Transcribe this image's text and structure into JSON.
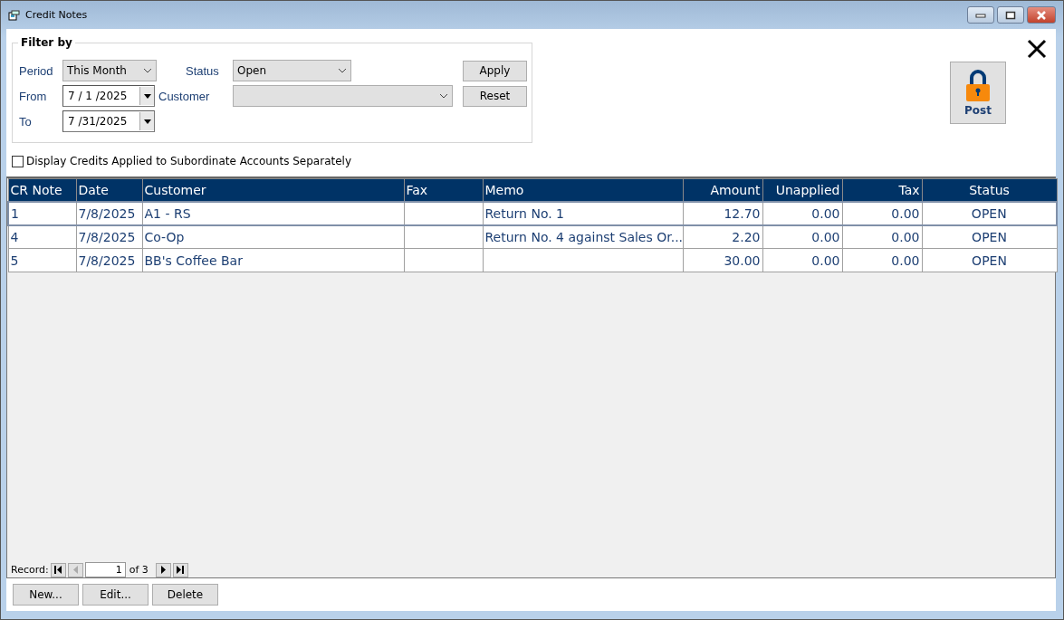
{
  "window": {
    "title": "Credit Notes"
  },
  "filter": {
    "title": "Filter by",
    "period": {
      "label": "Period",
      "value": "This Month"
    },
    "from": {
      "label": "From",
      "value": "7 / 1 /2025"
    },
    "to": {
      "label": "To",
      "value": "7 /31/2025"
    },
    "status": {
      "label": "Status",
      "value": "Open"
    },
    "customer": {
      "label": "Customer"
    },
    "buttons": [
      "Apply",
      "Reset"
    ]
  },
  "post_button": {
    "label": "Post"
  },
  "subordinate_checkbox": {
    "label": "Display Credits Applied to Subordinate Accounts Separately",
    "checked": false
  },
  "table": {
    "columns": [
      "CR Note",
      "Date",
      "Customer",
      "Fax",
      "Memo",
      "Amount",
      "Unapplied",
      "Tax",
      "Status"
    ],
    "rows": [
      {
        "cells": [
          "1",
          "7/8/2025",
          "A1 - RS",
          "",
          "Return No. 1",
          "12.70",
          "0.00",
          "0.00",
          "OPEN"
        ],
        "selected": true
      },
      {
        "cells": [
          "4",
          "7/8/2025",
          "Co-Op",
          "",
          "Return No. 4 against Sales Or...",
          "2.20",
          "0.00",
          "0.00",
          "OPEN"
        ],
        "selected": false
      },
      {
        "cells": [
          "5",
          "7/8/2025",
          "BB's Coffee Bar",
          "",
          "",
          "30.00",
          "0.00",
          "0.00",
          "OPEN"
        ],
        "selected": false
      }
    ]
  },
  "record_nav": {
    "label": "Record:",
    "value": "1",
    "total": "of 3",
    "buttons": [
      {
        "kind": "first",
        "disabled": false
      },
      {
        "kind": "prev",
        "disabled": true
      },
      {
        "kind": "next",
        "disabled": false
      },
      {
        "kind": "last",
        "disabled": false
      }
    ]
  },
  "buttons": [
    "New...",
    "Edit...",
    "Delete"
  ]
}
